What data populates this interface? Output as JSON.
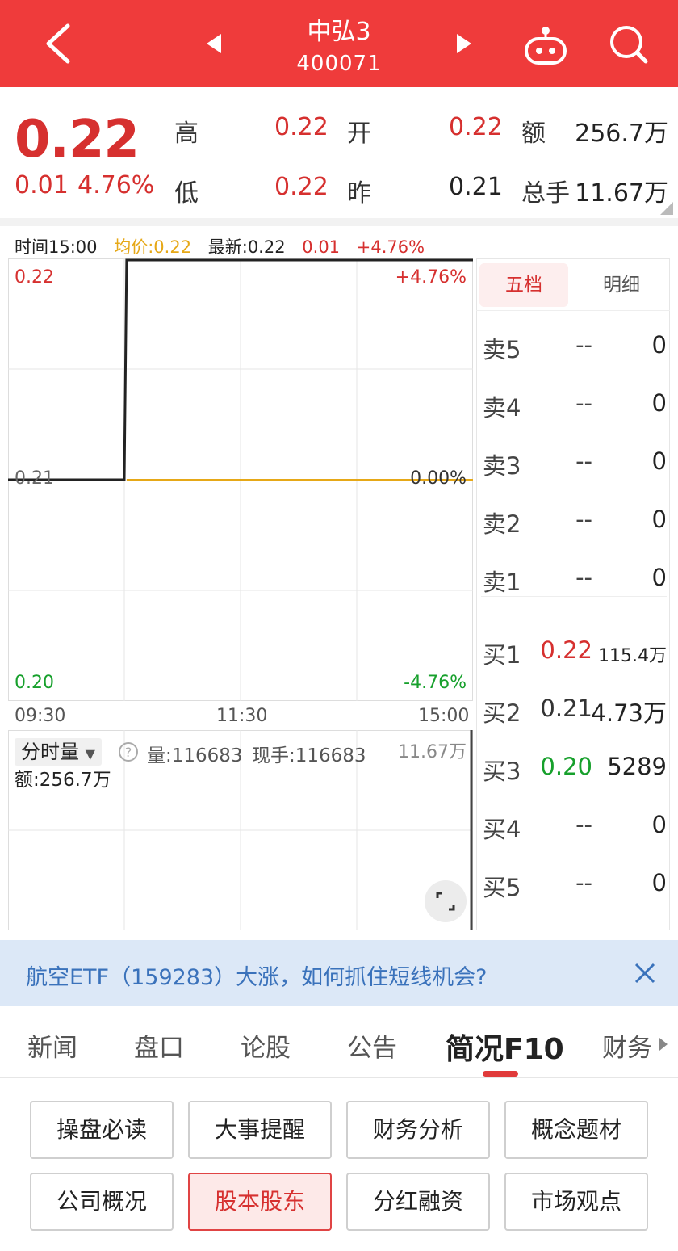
{
  "header": {
    "title": "中弘3",
    "code": "400071"
  },
  "quote": {
    "price": "0.22",
    "change": "0.01",
    "change_pct": "4.76%",
    "high_label": "高",
    "high": "0.22",
    "low_label": "低",
    "low": "0.22",
    "open_label": "开",
    "open": "0.22",
    "prev_label": "昨",
    "prev": "0.21",
    "amount_label": "额",
    "amount": "256.7万",
    "volume_label": "总手",
    "volume": "11.67万"
  },
  "chart_info": {
    "time": "时间15:00",
    "avg": "均价:0.22",
    "latest": "最新:0.22",
    "chg": "0.01",
    "pct": "+4.76%"
  },
  "chart_data": {
    "type": "line",
    "x_ticks": [
      "09:30",
      "11:30",
      "15:00"
    ],
    "y_ticks_left": [
      "0.22",
      "0.21",
      "0.20"
    ],
    "y_ticks_right": [
      "+4.76%",
      "0.00%",
      "-4.76%"
    ],
    "ylim": [
      0.2,
      0.22
    ],
    "series": [
      {
        "points": [
          [
            0,
            0.21
          ],
          [
            0.25,
            0.21
          ],
          [
            0.255,
            0.22
          ],
          [
            1,
            0.22
          ]
        ],
        "color": "#222222"
      },
      {
        "points": [
          [
            0.255,
            0.21
          ],
          [
            1,
            0.21
          ]
        ],
        "color": "#e6a817"
      }
    ]
  },
  "volume_panel": {
    "selector": "分时量",
    "help_icon": "question-circle-icon",
    "vol": "量:116683",
    "now_hand": "现手:116683",
    "max": "11.67万",
    "amount": "额:256.7万"
  },
  "orderbook": {
    "tabs": [
      "五档",
      "明细"
    ],
    "sells": [
      {
        "label": "卖5",
        "price": "--",
        "vol": "0"
      },
      {
        "label": "卖4",
        "price": "--",
        "vol": "0"
      },
      {
        "label": "卖3",
        "price": "--",
        "vol": "0"
      },
      {
        "label": "卖2",
        "price": "--",
        "vol": "0"
      },
      {
        "label": "卖1",
        "price": "--",
        "vol": "0"
      }
    ],
    "buys": [
      {
        "label": "买1",
        "price": "0.22",
        "vol": "115.4万"
      },
      {
        "label": "买2",
        "price": "0.21",
        "vol": "4.73万"
      },
      {
        "label": "买3",
        "price": "0.20",
        "vol": "5289"
      },
      {
        "label": "买4",
        "price": "--",
        "vol": "0"
      },
      {
        "label": "买5",
        "price": "--",
        "vol": "0"
      }
    ]
  },
  "banner": {
    "text": "航空ETF（159283）大涨，如何抓住短线机会?"
  },
  "tabs": [
    "新闻",
    "盘口",
    "论股",
    "公告",
    "简况F10",
    "财务"
  ],
  "f10_buttons": [
    "操盘必读",
    "大事提醒",
    "财务分析",
    "概念题材",
    "公司概况",
    "股本股东",
    "分红融资",
    "市场观点"
  ],
  "colors": {
    "header_bg": "#ef3b3b",
    "up": "#d6302f",
    "down": "#17a02c",
    "avg_line": "#e6a817",
    "banner_bg": "#dce8f7"
  }
}
